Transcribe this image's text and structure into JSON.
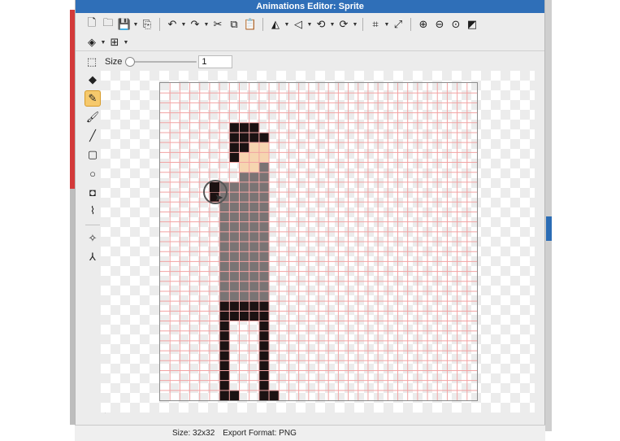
{
  "window": {
    "title": "Animations Editor: Sprite"
  },
  "toolbar": {
    "row1": [
      {
        "name": "new-file-icon",
        "glyph": "🗋",
        "caret": false
      },
      {
        "name": "open-folder-icon",
        "glyph": "🗀",
        "caret": false
      },
      {
        "name": "save-icon",
        "glyph": "💾",
        "caret": true
      },
      {
        "name": "import-icon",
        "glyph": "⎘",
        "caret": false
      },
      {
        "sep": true
      },
      {
        "name": "undo-icon",
        "glyph": "↶",
        "caret": true
      },
      {
        "name": "redo-icon",
        "glyph": "↷",
        "caret": true
      },
      {
        "name": "cut-icon",
        "glyph": "✂",
        "caret": false
      },
      {
        "name": "copy-icon",
        "glyph": "⧉",
        "caret": false
      },
      {
        "name": "paste-icon",
        "glyph": "📋",
        "caret": false
      },
      {
        "sep": true
      },
      {
        "name": "flip-horizontal-icon",
        "glyph": "◭",
        "caret": true
      },
      {
        "name": "flip-vertical-icon",
        "glyph": "◁",
        "caret": true
      },
      {
        "name": "rotate-left-icon",
        "glyph": "⟲",
        "caret": true
      },
      {
        "name": "rotate-right-icon",
        "glyph": "⟳",
        "caret": true
      },
      {
        "sep": true
      },
      {
        "name": "crop-icon",
        "glyph": "⌗",
        "caret": true
      },
      {
        "name": "resize-icon",
        "glyph": "⤢",
        "caret": false
      },
      {
        "sep": true
      },
      {
        "name": "zoom-in-icon",
        "glyph": "⊕",
        "caret": false
      },
      {
        "name": "zoom-out-icon",
        "glyph": "⊖",
        "caret": false
      },
      {
        "name": "zoom-fit-icon",
        "glyph": "⊙",
        "caret": false
      },
      {
        "name": "grid-toggle-icon",
        "glyph": "◩",
        "caret": false
      }
    ],
    "row2": [
      {
        "name": "layers-icon",
        "glyph": "◈",
        "caret": true
      },
      {
        "name": "grid-icon",
        "glyph": "⊞",
        "caret": true
      }
    ]
  },
  "options": {
    "size_label": "Size",
    "size_value": "1",
    "size_slider_fraction": 0.0
  },
  "tools": [
    {
      "name": "eraser-tool-icon",
      "glyph": "◆",
      "active": false
    },
    {
      "name": "pencil-tool-icon",
      "glyph": "✎",
      "active": true
    },
    {
      "name": "brush-tool-icon",
      "glyph": "🖌",
      "active": false
    },
    {
      "name": "line-tool-icon",
      "glyph": "╱",
      "active": false
    },
    {
      "name": "rectangle-tool-icon",
      "glyph": "▢",
      "active": false
    },
    {
      "name": "ellipse-tool-icon",
      "glyph": "○",
      "active": false
    },
    {
      "name": "fill-bucket-tool-icon",
      "glyph": "◘",
      "active": false
    },
    {
      "name": "eyedropper-tool-icon",
      "glyph": "⌇",
      "active": false
    },
    {
      "sep": true
    },
    {
      "name": "magic-wand-tool-icon",
      "glyph": "✧",
      "active": false
    },
    {
      "name": "transform-tool-icon",
      "glyph": "⅄",
      "active": false
    }
  ],
  "status": {
    "size_text": "Size: 32x32",
    "format_text": "Export Format: PNG"
  },
  "colors": {
    "grid_line": "#f2a3a3",
    "hair": "#1a1212",
    "skin": "#f6d5b0",
    "shirt": "#7a7474",
    "pants": "#1c1212",
    "titlebar": "#2f6fb8",
    "active_tool": "#f6c96c"
  },
  "sprite": {
    "grid_size": 32,
    "rows": [
      "................................",
      "................................",
      "................................",
      "................................",
      "..........................",
      "",
      "",
      "",
      "",
      "",
      "",
      "",
      "",
      "",
      "",
      "",
      "",
      "",
      "",
      "",
      "",
      "",
      "",
      "",
      "",
      "",
      "",
      "",
      "",
      "",
      "",
      ""
    ],
    "pixels": {
      "H": [
        [
          4,
          7
        ],
        [
          4,
          8
        ],
        [
          4,
          9
        ],
        [
          5,
          7
        ],
        [
          5,
          8
        ],
        [
          5,
          9
        ],
        [
          5,
          10
        ],
        [
          6,
          7
        ],
        [
          6,
          8
        ],
        [
          7,
          7
        ]
      ],
      "S": [
        [
          6,
          9
        ],
        [
          6,
          10
        ],
        [
          7,
          8
        ],
        [
          7,
          9
        ],
        [
          7,
          10
        ],
        [
          8,
          8
        ],
        [
          8,
          9
        ]
      ],
      "G": [
        [
          8,
          10
        ],
        [
          9,
          8
        ],
        [
          9,
          9
        ],
        [
          9,
          10
        ],
        [
          10,
          6
        ],
        [
          10,
          7
        ],
        [
          10,
          8
        ],
        [
          10,
          9
        ],
        [
          10,
          10
        ],
        [
          11,
          6
        ],
        [
          11,
          7
        ],
        [
          11,
          8
        ],
        [
          11,
          9
        ],
        [
          11,
          10
        ],
        [
          12,
          6
        ],
        [
          12,
          7
        ],
        [
          12,
          8
        ],
        [
          12,
          9
        ],
        [
          12,
          10
        ],
        [
          13,
          6
        ],
        [
          13,
          7
        ],
        [
          13,
          8
        ],
        [
          13,
          9
        ],
        [
          13,
          10
        ],
        [
          14,
          6
        ],
        [
          14,
          7
        ],
        [
          14,
          8
        ],
        [
          14,
          9
        ],
        [
          14,
          10
        ],
        [
          15,
          6
        ],
        [
          15,
          7
        ],
        [
          15,
          8
        ],
        [
          15,
          9
        ],
        [
          15,
          10
        ],
        [
          16,
          6
        ],
        [
          16,
          7
        ],
        [
          16,
          8
        ],
        [
          16,
          9
        ],
        [
          16,
          10
        ],
        [
          17,
          6
        ],
        [
          17,
          7
        ],
        [
          17,
          8
        ],
        [
          17,
          9
        ],
        [
          17,
          10
        ],
        [
          18,
          6
        ],
        [
          18,
          7
        ],
        [
          18,
          8
        ],
        [
          18,
          9
        ],
        [
          18,
          10
        ],
        [
          19,
          6
        ],
        [
          19,
          7
        ],
        [
          19,
          8
        ],
        [
          19,
          9
        ],
        [
          19,
          10
        ],
        [
          20,
          6
        ],
        [
          20,
          7
        ],
        [
          20,
          8
        ],
        [
          20,
          9
        ],
        [
          20,
          10
        ],
        [
          21,
          6
        ],
        [
          21,
          7
        ],
        [
          21,
          8
        ],
        [
          21,
          9
        ],
        [
          21,
          10
        ]
      ],
      "P": [
        [
          10,
          5
        ],
        [
          11,
          5
        ],
        [
          22,
          6
        ],
        [
          22,
          7
        ],
        [
          22,
          8
        ],
        [
          22,
          9
        ],
        [
          22,
          10
        ],
        [
          23,
          6
        ],
        [
          23,
          7
        ],
        [
          23,
          8
        ],
        [
          23,
          9
        ],
        [
          23,
          10
        ],
        [
          24,
          6
        ],
        [
          24,
          10
        ],
        [
          25,
          6
        ],
        [
          25,
          10
        ],
        [
          26,
          6
        ],
        [
          26,
          10
        ],
        [
          27,
          6
        ],
        [
          27,
          10
        ],
        [
          28,
          6
        ],
        [
          28,
          10
        ],
        [
          29,
          6
        ],
        [
          29,
          10
        ],
        [
          30,
          6
        ],
        [
          30,
          10
        ],
        [
          31,
          6
        ],
        [
          31,
          7
        ],
        [
          31,
          10
        ],
        [
          31,
          11
        ]
      ]
    }
  }
}
